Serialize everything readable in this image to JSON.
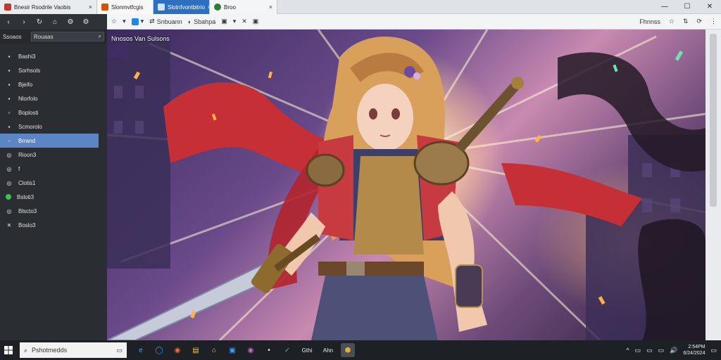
{
  "tabs": [
    {
      "label": "Bnesir Rsodrile Vaobis",
      "close": "×",
      "favicon_color": "#c0392b"
    },
    {
      "label": "Slonmvtfcgis",
      "close": "",
      "favicon_color": "#d35400"
    },
    {
      "label": "Slotnfvontbitrio",
      "close": "×",
      "favicon_color": "#1565c0"
    },
    {
      "label": "Broo",
      "close": "×",
      "favicon_color": "#2e7d32"
    }
  ],
  "window_controls": {
    "minimize": "—",
    "maximize": "☐",
    "close": "✕"
  },
  "left_panel": {
    "toolbar_icons": [
      "‹",
      "›",
      "↻",
      "⌂",
      "⚙",
      "⚙"
    ],
    "search_label": "Ssoaos",
    "search_value": "Rouaas",
    "items": [
      {
        "label": "Bashi3",
        "icon": "▪"
      },
      {
        "label": "Sorhsols",
        "icon": "▪"
      },
      {
        "label": "Bjeifo",
        "icon": "▪"
      },
      {
        "label": "Nlorfolo",
        "icon": "▪"
      },
      {
        "label": "Boplosti",
        "icon": "▫"
      },
      {
        "label": "Scmorolo",
        "icon": "▪"
      },
      {
        "label": "Brrand",
        "icon": "−",
        "selected": true
      },
      {
        "label": "Rioon3",
        "icon": "◎"
      },
      {
        "label": "f",
        "icon": "◎"
      },
      {
        "label": "Clotis1",
        "icon": "◎"
      },
      {
        "label": "Bsloti3",
        "icon": "◉",
        "status": "online"
      },
      {
        "label": "Blscto3",
        "icon": "◎"
      },
      {
        "label": "Boslo3",
        "icon": "✕"
      }
    ]
  },
  "browser_toolbar": {
    "items": [
      {
        "label": "",
        "icon": "☆"
      },
      {
        "label": "",
        "icon": "▾"
      },
      {
        "label": "",
        "icon": "▾"
      },
      {
        "label": "Snbuann",
        "icon": "⇄"
      },
      {
        "label": "Sbahpa",
        "icon": "◐"
      },
      {
        "label": "",
        "icon": "▣"
      },
      {
        "label": "",
        "icon": "▾"
      },
      {
        "label": "",
        "icon": "✕"
      },
      {
        "label": "",
        "icon": "▣"
      }
    ],
    "right_label": "Fhnnss",
    "right_icons": [
      "☆",
      "⇅",
      "⟳",
      "⋮"
    ]
  },
  "content": {
    "title": "Nnosos Van Sulsons"
  },
  "taskbar": {
    "search_placeholder": "Pshotmedds",
    "icons": [
      "e",
      "◯",
      "◉",
      "▤",
      "⌂",
      "▣",
      "◉",
      "•",
      "✓"
    ],
    "text_items": [
      "Gthi",
      "Ahn"
    ],
    "tray_icons": [
      "^",
      "▭",
      "▭",
      "▭",
      "🔊"
    ],
    "clock_time": "2:54PM",
    "clock_date": "6/24/2024"
  }
}
